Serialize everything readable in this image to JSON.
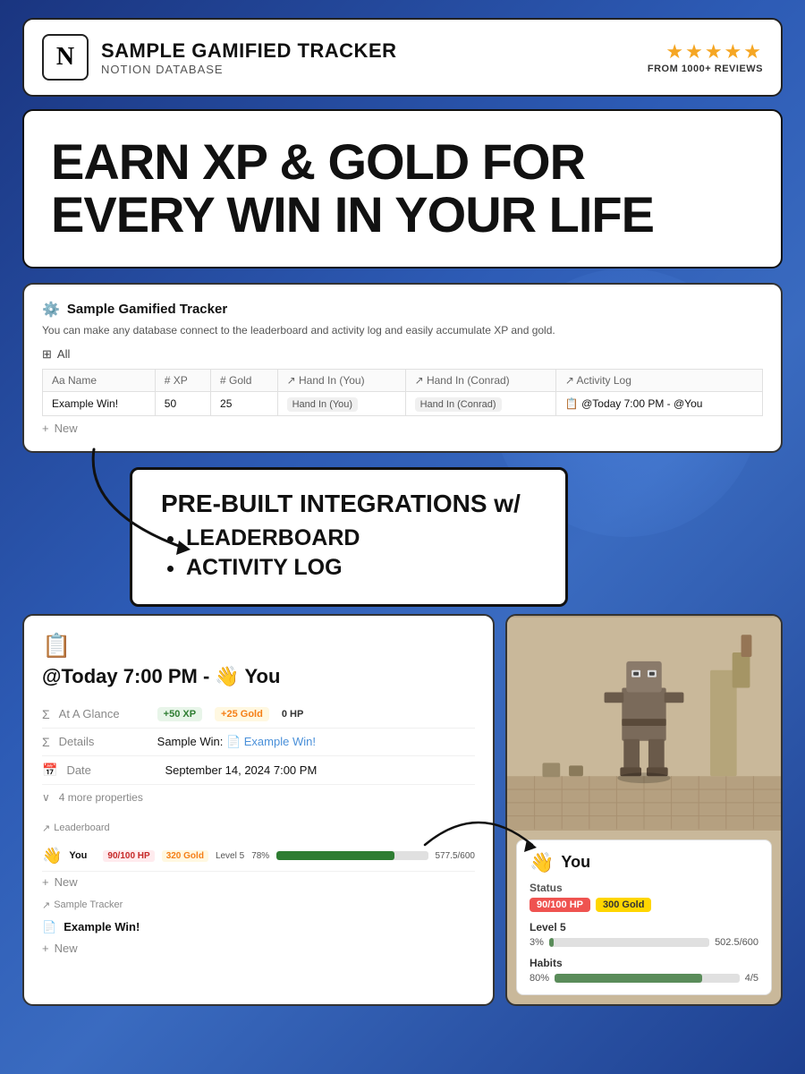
{
  "header": {
    "logo_text": "N",
    "app_title": "SAMPLE GAMIFIED TRACKER",
    "app_subtitle": "NOTION DATABASE",
    "stars": "★★★★★",
    "review_text": "FROM 1000+ REVIEWS"
  },
  "hero": {
    "line1": "EARN XP & GOLD FOR",
    "line2": "EVERY WIN IN YOUR LIFE"
  },
  "notion_db": {
    "icon": "⚙️",
    "name": "Sample Gamified Tracker",
    "description": "You can make any database connect to the leaderboard and activity log and easily accumulate XP and gold.",
    "view_label": "All",
    "table": {
      "headers": [
        "Name",
        "XP",
        "Gold",
        "Hand In (You)",
        "Hand In (Conrad)",
        "Activity Log"
      ],
      "row": {
        "name": "Example Win!",
        "xp": "50",
        "gold": "25",
        "hand_in_you": "Hand In (You)",
        "hand_in_conrad": "Hand In (Conrad)",
        "activity_log": "@Today 7:00 PM - @You"
      },
      "new_row": "New"
    }
  },
  "integration": {
    "title": "PRE-BUILT INTEGRATIONS w/",
    "items": [
      "LEADERBOARD",
      "ACTIVITY LOG"
    ]
  },
  "activity_log": {
    "icon": "📋",
    "title": "@Today 7:00 PM - 👋 You",
    "rows": [
      {
        "label": "At A Glance",
        "type": "badges"
      },
      {
        "label": "Details",
        "value": "Sample Win: 📄 Example Win!"
      },
      {
        "label": "Date",
        "value": "September 14, 2024 7:00 PM"
      },
      {
        "label": "more_props",
        "value": "4 more properties"
      }
    ],
    "badges": {
      "xp": "+50 XP",
      "gold": "+25 Gold",
      "hp": "0 HP"
    },
    "leaderboard": {
      "label": "Leaderboard",
      "user": {
        "avatar": "👋",
        "name": "You",
        "hp_badge": "90/100 HP",
        "gold_badge": "320 Gold",
        "level": "Level 5",
        "pct": "78%",
        "score": "577.5/600",
        "progress_width": 78
      },
      "new_label": "New"
    },
    "sample_tracker": {
      "label": "Sample Tracker",
      "item": "Example Win!",
      "new_label": "New"
    }
  },
  "character": {
    "avatar": "👋",
    "name": "You",
    "status_label": "Status",
    "hp": "90/100 HP",
    "gold": "300 Gold",
    "level": "Level 5",
    "progress_pct": "3%",
    "progress_value": "502.5/600",
    "progress_width": 3,
    "habits_label": "Habits",
    "habits_pct": "80%",
    "habits_value": "4/5",
    "habits_width": 80
  }
}
